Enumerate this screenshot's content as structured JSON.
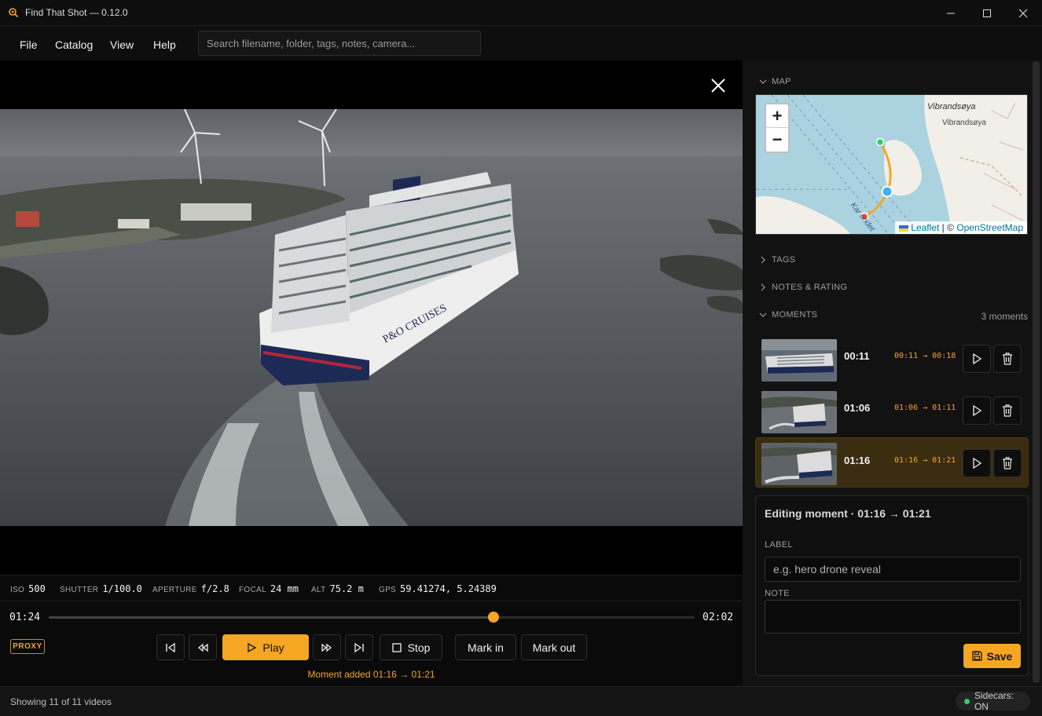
{
  "app": {
    "title": "Find That Shot — 0.12.0",
    "accent_color": "#f5a623"
  },
  "menu": {
    "items": [
      "File",
      "Catalog",
      "View",
      "Help"
    ],
    "search_placeholder": "Search filename, folder, tags, notes, camera..."
  },
  "meta": {
    "iso_label": "ISO",
    "iso_value": "500",
    "shutter_label": "SHUTTER",
    "shutter_value": "1/100.0",
    "aperture_label": "APERTURE",
    "aperture_value": "f/2.8",
    "focal_label": "FOCAL",
    "focal_value": "24 mm",
    "alt_label": "ALT",
    "alt_value": "75.2 m",
    "gps_label": "GPS",
    "gps_value": "59.41274, 5.24389"
  },
  "playback": {
    "current_time": "01:24",
    "duration": "02:02",
    "progress_fraction": 0.688,
    "proxy_badge": "PROXY",
    "play_label": "Play",
    "stop_label": "Stop",
    "mark_in_label": "Mark in",
    "mark_out_label": "Mark out",
    "status_message": "Moment added 01:16 → 01:21"
  },
  "sidebar": {
    "map_header": "MAP",
    "tags_header": "TAGS",
    "notes_header": "NOTES & RATING",
    "moments_header": "MOMENTS",
    "moments_count": "3 moments",
    "map": {
      "zoom_in": "+",
      "zoom_out": "−",
      "place_label_1": "Vibrandsøya",
      "place_label_2": "Vibrandsøya",
      "road_label": "Kar    undet",
      "attr_leaflet": "Leaflet",
      "attr_sep": "| ©",
      "attr_osm": "OpenStreetMap"
    },
    "moments": [
      {
        "time": "00:11",
        "range": "00:11 → 00:18",
        "active": false
      },
      {
        "time": "01:06",
        "range": "01:06 → 01:11",
        "active": false
      },
      {
        "time": "01:16",
        "range": "01:16 → 01:21",
        "active": true
      }
    ],
    "editor": {
      "title": "Editing moment · 01:16 → 01:21",
      "label_heading": "LABEL",
      "label_placeholder": "e.g. hero drone reveal",
      "note_heading": "NOTE",
      "save_label": "Save"
    }
  },
  "statusbar": {
    "text": "Showing 11 of 11 videos",
    "sidecars": "Sidecars: ON"
  }
}
